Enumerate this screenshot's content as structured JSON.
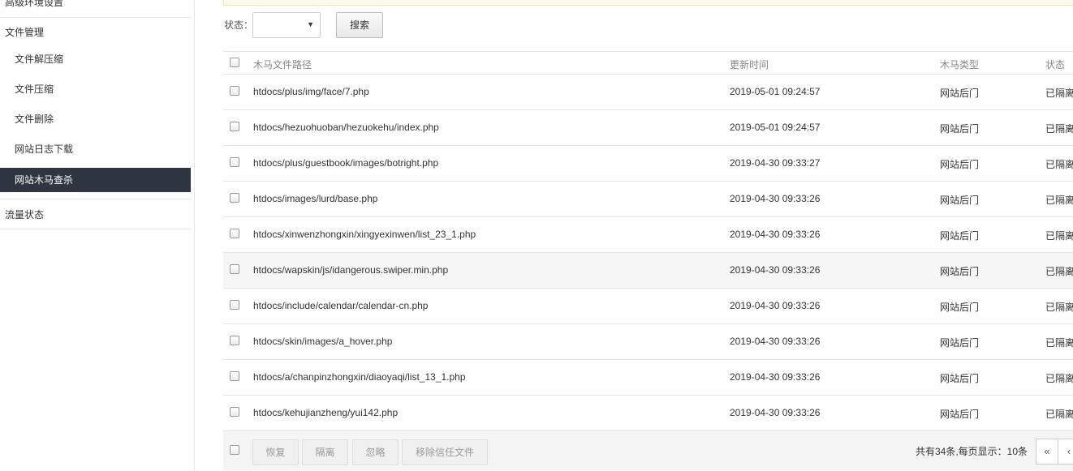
{
  "sidebar": {
    "top_item": "高级环境设置",
    "file_group": "文件管理",
    "file_items": [
      "文件解压缩",
      "文件压缩",
      "文件删除",
      "网站日志下载",
      "网站木马查杀"
    ],
    "active_item": "网站木马查杀",
    "traffic_group": "流量状态"
  },
  "filter": {
    "status_label": "状态：",
    "status_value": "",
    "search_label": "搜索"
  },
  "table": {
    "columns": [
      "木马文件路径",
      "更新时间",
      "木马类型",
      "状态"
    ],
    "rows": [
      {
        "path": "htdocs/plus/img/face/7.php",
        "time": "2019-05-01 09:24:57",
        "type": "网站后门",
        "status": "已隔离"
      },
      {
        "path": "htdocs/hezuohuoban/hezuokehu/index.php",
        "time": "2019-05-01 09:24:57",
        "type": "网站后门",
        "status": "已隔离"
      },
      {
        "path": "htdocs/plus/guestbook/images/botright.php",
        "time": "2019-04-30 09:33:27",
        "type": "网站后门",
        "status": "已隔离"
      },
      {
        "path": "htdocs/images/lurd/base.php",
        "time": "2019-04-30 09:33:26",
        "type": "网站后门",
        "status": "已隔离"
      },
      {
        "path": "htdocs/xinwenzhongxin/xingyexinwen/list_23_1.php",
        "time": "2019-04-30 09:33:26",
        "type": "网站后门",
        "status": "已隔离"
      },
      {
        "path": "htdocs/wapskin/js/idangerous.swiper.min.php",
        "time": "2019-04-30 09:33:26",
        "type": "网站后门",
        "status": "已隔离"
      },
      {
        "path": "htdocs/include/calendar/calendar-cn.php",
        "time": "2019-04-30 09:33:26",
        "type": "网站后门",
        "status": "已隔离"
      },
      {
        "path": "htdocs/skin/images/a_hover.php",
        "time": "2019-04-30 09:33:26",
        "type": "网站后门",
        "status": "已隔离"
      },
      {
        "path": "htdocs/a/chanpinzhongxin/diaoyaqi/list_13_1.php",
        "time": "2019-04-30 09:33:26",
        "type": "网站后门",
        "status": "已隔离"
      },
      {
        "path": "htdocs/kehujianzheng/yui142.php",
        "time": "2019-04-30 09:33:26",
        "type": "网站后门",
        "status": "已隔离"
      }
    ]
  },
  "footer": {
    "buttons": [
      "恢复",
      "隔离",
      "忽略",
      "移除信任文件"
    ],
    "total_text": "共有34条,每页显示：10条",
    "first_page": "«",
    "prev_page": "‹"
  },
  "colors": {
    "active_bg": "#2f3541",
    "highlight_row": "#f6f6f6",
    "notice_bg": "#fffbea"
  }
}
